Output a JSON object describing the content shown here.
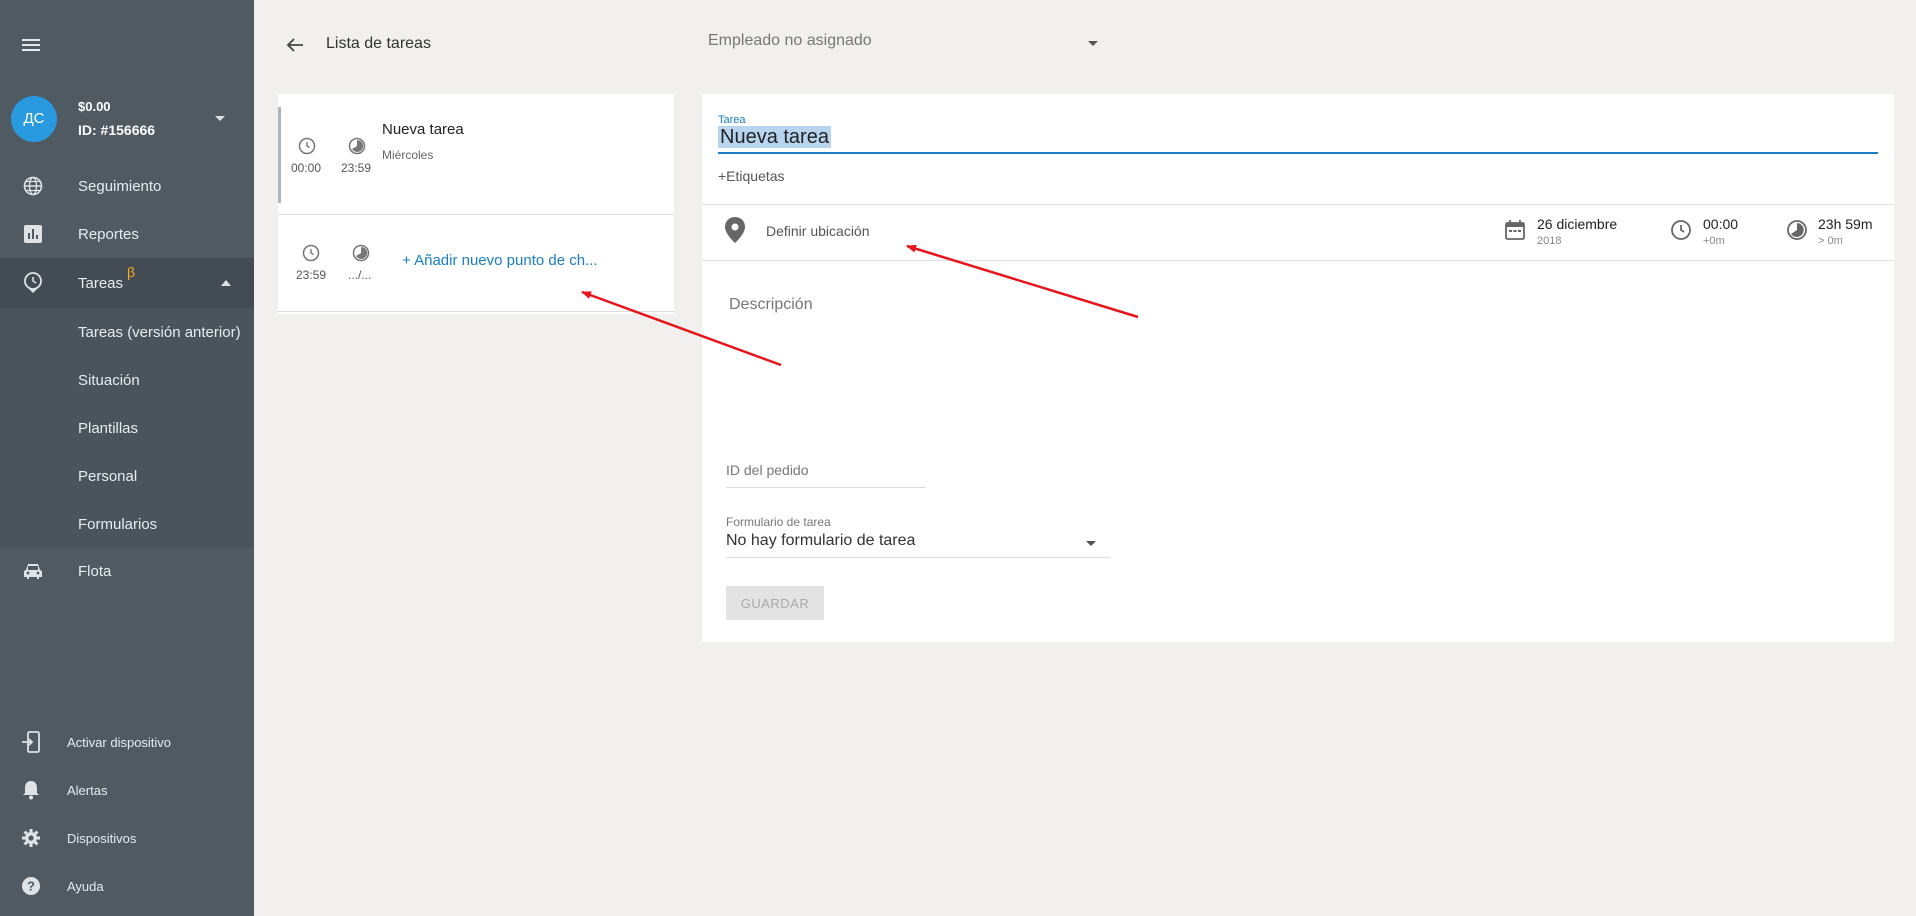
{
  "sidebar": {
    "account": {
      "initials": "ДС",
      "balance": "$0.00",
      "id": "ID: #156666"
    },
    "items": [
      {
        "label": "Seguimiento",
        "icon": "globe-icon"
      },
      {
        "label": "Reportes",
        "icon": "chart-icon"
      },
      {
        "label": "Tareas",
        "icon": "clock-icon",
        "badge": "β"
      },
      {
        "label": "Flota",
        "icon": "car-icon"
      }
    ],
    "subitems": [
      {
        "label": "Tareas (versión anterior)"
      },
      {
        "label": "Situación"
      },
      {
        "label": "Plantillas"
      },
      {
        "label": "Personal"
      },
      {
        "label": "Formularios"
      }
    ],
    "bottom": [
      {
        "label": "Activar dispositivo",
        "icon": "device-login-icon"
      },
      {
        "label": "Alertas",
        "icon": "bell-icon"
      },
      {
        "label": "Dispositivos",
        "icon": "gear-icon"
      },
      {
        "label": "Ayuda",
        "icon": "help-icon"
      }
    ]
  },
  "header": {
    "title": "Lista de tareas",
    "employee": "Empleado no asignado"
  },
  "task_list": {
    "task": {
      "start": "00:00",
      "end": "23:59",
      "name": "Nueva tarea",
      "day": "Miércoles"
    },
    "checkpoint": {
      "start": "23:59",
      "end": ".../...",
      "add_label": "+ Añadir nuevo punto de ch..."
    }
  },
  "detail": {
    "task_label": "Tarea",
    "task_name": "Nueva tarea",
    "tags": "+Etiquetas",
    "location": "Definir ubicación",
    "date": {
      "main": "26 diciembre",
      "sub": "2018"
    },
    "start": {
      "main": "00:00",
      "sub": "+0m"
    },
    "duration": {
      "main": "23h 59m",
      "sub": "> 0m"
    },
    "description_placeholder": "Descripción",
    "order_id_placeholder": "ID del pedido",
    "form_label": "Formulario de tarea",
    "form_value": "No hay formulario de tarea",
    "save_label": "GUARDAR"
  },
  "colors": {
    "sidebar": "#4f5a63",
    "accent": "#1a7fc8",
    "avatar": "#2a9ae0",
    "beta": "#f5a623",
    "arrow": "#e8141c"
  }
}
